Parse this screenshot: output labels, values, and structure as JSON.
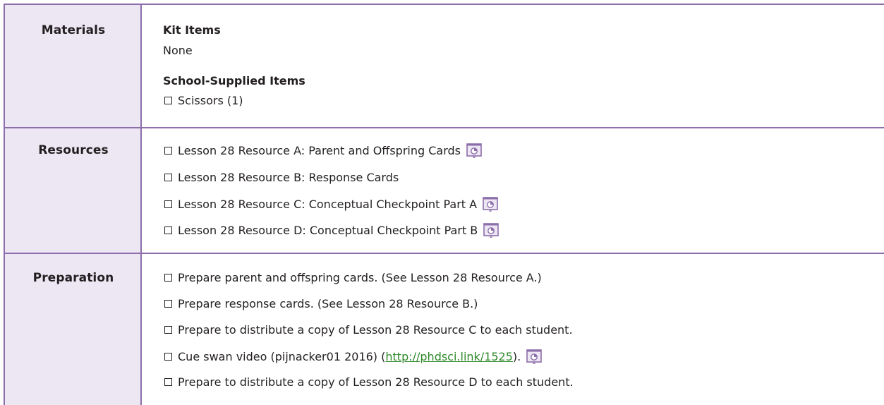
{
  "rows": {
    "materials": {
      "label": "Materials",
      "kit_heading": "Kit Items",
      "kit_value": "None",
      "school_heading": "School-Supplied Items",
      "school_items": [
        "Scissors (1)"
      ]
    },
    "resources": {
      "label": "Resources",
      "items": [
        "Lesson 28 Resource A: Parent and Offspring Cards",
        "Lesson 28 Resource B: Response Cards",
        "Lesson 28 Resource C: Conceptual Checkpoint Part A",
        "Lesson 28 Resource D: Conceptual Checkpoint Part B"
      ]
    },
    "preparation": {
      "label": "Preparation",
      "items": [
        "Prepare parent and offspring cards. (See Lesson 28 Resource A.)",
        "Prepare response cards. (See Lesson 28 Resource B.)",
        "Prepare to distribute a copy of Lesson 28 Resource C to each student.",
        "Prepare to distribute a copy of Lesson 28 Resource D to each student."
      ],
      "video_item": {
        "prefix": "Cue swan video (pijnacker01 2016) (",
        "link": "http://phdsci.link/1525",
        "suffix": ")."
      }
    }
  },
  "icons": {
    "projector": "projection-screen-icon"
  },
  "colors": {
    "rule": "#8c6eab",
    "label_bg": "#ede6f3",
    "link": "#2e8a2a"
  }
}
